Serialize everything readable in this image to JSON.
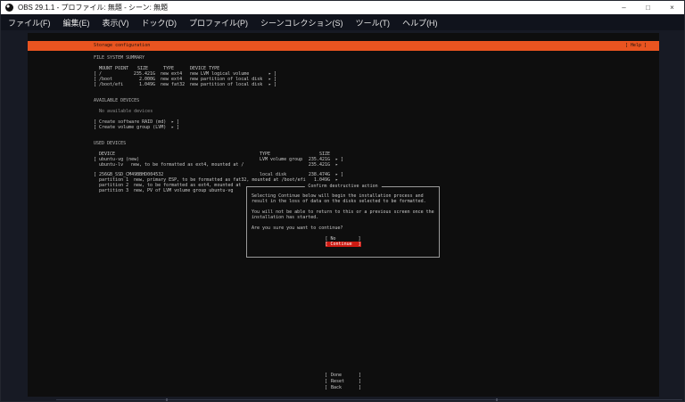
{
  "window": {
    "title": "OBS 29.1.1 - プロファイル: 無題 - シーン: 無題",
    "controls": {
      "minimize": "–",
      "maximize": "□",
      "close": "×"
    }
  },
  "menubar": {
    "items": [
      "ファイル(F)",
      "編集(E)",
      "表示(V)",
      "ドック(D)",
      "プロファイル(P)",
      "シーンコレクション(S)",
      "ツール(T)",
      "ヘルプ(H)"
    ]
  },
  "installer": {
    "colors": {
      "header_bg": "#e95420",
      "focus_bg": "#cc1a12",
      "terminal_bg": "#0e0e0e",
      "text": "#c9c9c9"
    },
    "glyphs": {
      "open": "[",
      "close": "]",
      "more": "▸",
      "more_close": "▸ ]"
    },
    "header": {
      "title": "Storage configuration",
      "help_button": "[ Help ]"
    },
    "file_system_summary": {
      "heading": "FILE SYSTEM SUMMARY",
      "columns": {
        "mount_point": "MOUNT POINT",
        "size": "SIZE",
        "type": "TYPE",
        "device_type": "DEVICE TYPE"
      },
      "rows": [
        {
          "mount_point": "/",
          "size": "235.421G",
          "type": "new ext4",
          "device_type": "new LVM logical volume"
        },
        {
          "mount_point": "/boot",
          "size": "2.000G",
          "type": "new ext4",
          "device_type": "new partition of local disk"
        },
        {
          "mount_point": "/boot/efi",
          "size": "1.049G",
          "type": "new fat32",
          "device_type": "new partition of local disk"
        }
      ]
    },
    "available_devices": {
      "heading": "AVAILABLE DEVICES",
      "empty_text": "No available devices",
      "buttons": [
        "Create software RAID (md)",
        "Create volume group (LVM)"
      ]
    },
    "used_devices": {
      "heading": "USED DEVICES",
      "columns": {
        "device": "DEVICE",
        "type": "TYPE",
        "size": "SIZE"
      },
      "volume_group": {
        "name": "ubuntu-vg (new)",
        "type": "LVM volume group",
        "size": "235.421G",
        "children": [
          {
            "name": "ubuntu-lv",
            "desc": "new, to be formatted as ext4, mounted at /",
            "size": "235.421G"
          }
        ]
      },
      "disk": {
        "name": "256GB_SSD_CM49BBHD004532",
        "type": "local disk",
        "size": "238.474G",
        "partitions": [
          {
            "name": "partition 1",
            "desc": "new, primary ESP, to be formatted as fat32, mounted at /boot/efi",
            "size": "1.049G"
          },
          {
            "name": "partition 2",
            "desc": "new, to be formatted as ext4, mounted at",
            "size": ""
          },
          {
            "name": "partition 3",
            "desc": "new, PV of LVM volume group ubuntu-vg",
            "size": ""
          }
        ]
      }
    },
    "dialog": {
      "title": "Confirm destructive action",
      "paragraphs": [
        "Selecting Continue below will begin the installation process and result in the loss of data on the disks selected to be formatted.",
        "You will not be able to return to this or a previous screen once the installation has started.",
        "Are you sure you want to continue?"
      ],
      "buttons": {
        "no": "No",
        "continue": "Continue"
      }
    },
    "footer": {
      "buttons": [
        "Done",
        "Reset",
        "Back"
      ]
    }
  }
}
